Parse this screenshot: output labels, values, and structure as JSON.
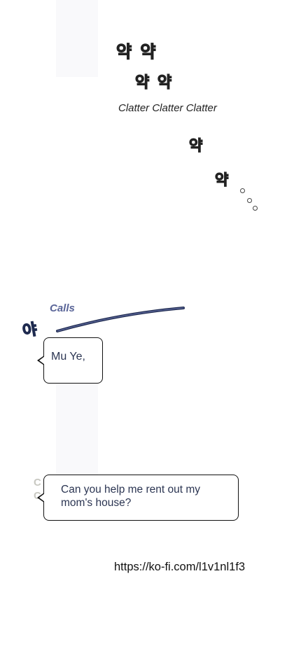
{
  "sfx": {
    "line1": "약 약",
    "line2": "약 약",
    "line3": "약",
    "line4": "약"
  },
  "caption": "Clatter Clatter Clatter",
  "calls": {
    "label": "Calls",
    "sfx": "야"
  },
  "bubbles": [
    {
      "text": "Mu Ye,"
    },
    {
      "line1": "Can you help me rent out my",
      "line2": "mom's house?"
    }
  ],
  "watermark": {
    "line1": "C",
    "line2": "C"
  },
  "link": "https://ko-fi.com/l1v1nl1f3",
  "colors": {
    "calls_accent": "#5a6598",
    "bubble_text": "#2b3552"
  }
}
